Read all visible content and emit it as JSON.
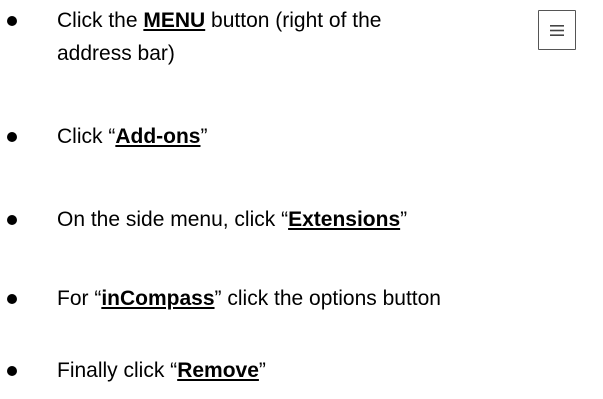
{
  "steps": [
    {
      "pre": "Click the ",
      "keyword": "MENU",
      "post": " button (right of the",
      "line2": "address bar)",
      "icon": "hamburger-menu-icon"
    },
    {
      "pre": "Click “",
      "keyword": "Add-ons",
      "post": "”"
    },
    {
      "pre": "On the side menu, click “",
      "keyword": "Extensions",
      "post": "”"
    },
    {
      "pre": "For “",
      "keyword": "inCompass",
      "post": "” click the options button"
    },
    {
      "pre": "Finally click “",
      "keyword": "Remove",
      "post": "”"
    }
  ],
  "colors": {
    "text": "#000000",
    "icon_border": "#555555",
    "background": "#ffffff"
  }
}
